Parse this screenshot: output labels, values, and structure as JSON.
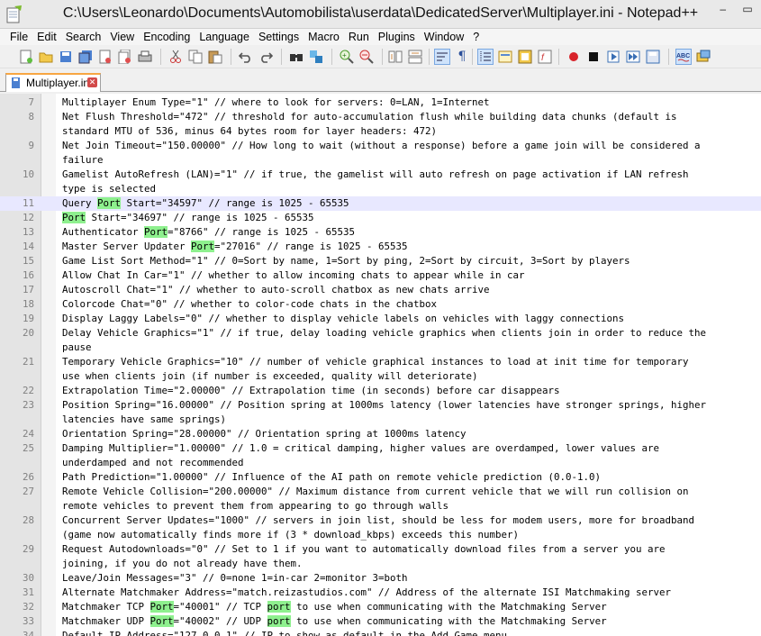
{
  "window": {
    "title": "C:\\Users\\Leonardo\\Documents\\Automobilista\\userdata\\DedicatedServer\\Multiplayer.ini - Notepad++",
    "minimize_glyph": "–",
    "maximize_glyph": "▭"
  },
  "menu": [
    "File",
    "Edit",
    "Search",
    "View",
    "Encoding",
    "Language",
    "Settings",
    "Macro",
    "Run",
    "Plugins",
    "Window",
    "?"
  ],
  "tab": {
    "label": "Multiplayer.ini",
    "close_glyph": "✕"
  },
  "highlight_term": "Port",
  "current_line": 11,
  "lines": [
    {
      "n": "7",
      "segs": [
        "Multiplayer Enum Type=\"1\" // where to look for servers: 0=LAN, 1=Internet"
      ]
    },
    {
      "n": "8",
      "segs": [
        "Net Flush Threshold=\"472\" // threshold for auto-accumulation flush while building data chunks (default is"
      ]
    },
    {
      "n": "",
      "segs": [
        "standard MTU of 536, minus 64 bytes room for layer headers: 472)"
      ]
    },
    {
      "n": "9",
      "segs": [
        "Net Join Timeout=\"150.00000\" // How long to wait (without a response) before a game join will be considered a"
      ]
    },
    {
      "n": "",
      "segs": [
        "failure"
      ]
    },
    {
      "n": "10",
      "segs": [
        "Gamelist AutoRefresh (LAN)=\"1\" // if true, the gamelist will auto refresh on page activation if LAN refresh"
      ]
    },
    {
      "n": "",
      "segs": [
        "type is selected"
      ]
    },
    {
      "n": "11",
      "segs": [
        "Query ",
        {
          "h": "Port"
        },
        " Start=\"34597\" // range is 1025 - 65535"
      ]
    },
    {
      "n": "12",
      "segs": [
        {
          "h": "Port"
        },
        " Start=\"34697\" // range is 1025 - 65535"
      ]
    },
    {
      "n": "13",
      "segs": [
        "Authenticator ",
        {
          "h": "Port"
        },
        "=\"8766\" // range is 1025 - 65535"
      ]
    },
    {
      "n": "14",
      "segs": [
        "Master Server Updater ",
        {
          "h": "Port"
        },
        "=\"27016\" // range is 1025 - 65535"
      ]
    },
    {
      "n": "15",
      "segs": [
        "Game List Sort Method=\"1\" // 0=Sort by name, 1=Sort by ping, 2=Sort by circuit, 3=Sort by players"
      ]
    },
    {
      "n": "16",
      "segs": [
        "Allow Chat In Car=\"1\" // whether to allow incoming chats to appear while in car"
      ]
    },
    {
      "n": "17",
      "segs": [
        "Autoscroll Chat=\"1\" // whether to auto-scroll chatbox as new chats arrive"
      ]
    },
    {
      "n": "18",
      "segs": [
        "Colorcode Chat=\"0\" // whether to color-code chats in the chatbox"
      ]
    },
    {
      "n": "19",
      "segs": [
        "Display Laggy Labels=\"0\" // whether to display vehicle labels on vehicles with laggy connections"
      ]
    },
    {
      "n": "20",
      "segs": [
        "Delay Vehicle Graphics=\"1\" // if true, delay loading vehicle graphics when clients join in order to reduce the"
      ]
    },
    {
      "n": "",
      "segs": [
        "pause"
      ]
    },
    {
      "n": "21",
      "segs": [
        "Temporary Vehicle Graphics=\"10\" // number of vehicle graphical instances to load at init time for temporary"
      ]
    },
    {
      "n": "",
      "segs": [
        "use when clients join (if number is exceeded, quality will deteriorate)"
      ]
    },
    {
      "n": "22",
      "segs": [
        "Extrapolation Time=\"2.00000\" // Extrapolation time (in seconds) before car disappears"
      ]
    },
    {
      "n": "23",
      "segs": [
        "Position Spring=\"16.00000\" // Position spring at 1000ms latency (lower latencies have stronger springs, higher"
      ]
    },
    {
      "n": "",
      "segs": [
        "latencies have same springs)"
      ]
    },
    {
      "n": "24",
      "segs": [
        "Orientation Spring=\"28.00000\" // Orientation spring at 1000ms latency"
      ]
    },
    {
      "n": "25",
      "segs": [
        "Damping Multiplier=\"1.00000\" // 1.0 = critical damping, higher values are overdamped, lower values are"
      ]
    },
    {
      "n": "",
      "segs": [
        "underdamped and not recommended"
      ]
    },
    {
      "n": "26",
      "segs": [
        "Path Prediction=\"1.00000\" // Influence of the AI path on remote vehicle prediction (0.0-1.0)"
      ]
    },
    {
      "n": "27",
      "segs": [
        "Remote Vehicle Collision=\"200.00000\" // Maximum distance from current vehicle that we will run collision on"
      ]
    },
    {
      "n": "",
      "segs": [
        "remote vehicles to prevent them from appearing to go through walls"
      ]
    },
    {
      "n": "28",
      "segs": [
        "Concurrent Server Updates=\"1000\" // servers in join list, should be less for modem users, more for broadband"
      ]
    },
    {
      "n": "",
      "segs": [
        "(game now automatically finds more if (3 * download_kbps) exceeds this number)"
      ]
    },
    {
      "n": "29",
      "segs": [
        "Request Autodownloads=\"0\" // Set to 1 if you want to automatically download files from a server you are"
      ]
    },
    {
      "n": "",
      "segs": [
        "joining, if you do not already have them."
      ]
    },
    {
      "n": "30",
      "segs": [
        "Leave/Join Messages=\"3\" // 0=none 1=in-car 2=monitor 3=both"
      ]
    },
    {
      "n": "31",
      "segs": [
        "Alternate Matchmaker Address=\"match.reizastudios.com\" // Address of the alternate ISI Matchmaking server"
      ]
    },
    {
      "n": "32",
      "segs": [
        "Matchmaker TCP ",
        {
          "h": "Port"
        },
        "=\"40001\" // TCP ",
        {
          "h": "port"
        },
        " to use when communicating with the Matchmaking Server"
      ]
    },
    {
      "n": "33",
      "segs": [
        "Matchmaker UDP ",
        {
          "h": "Port"
        },
        "=\"40002\" // UDP ",
        {
          "h": "port"
        },
        " to use when communicating with the Matchmaking Server"
      ]
    },
    {
      "n": "34",
      "segs": [
        "Default IP Address=\"127.0.0.1\" // IP to show as default in the Add Game menu"
      ]
    }
  ]
}
